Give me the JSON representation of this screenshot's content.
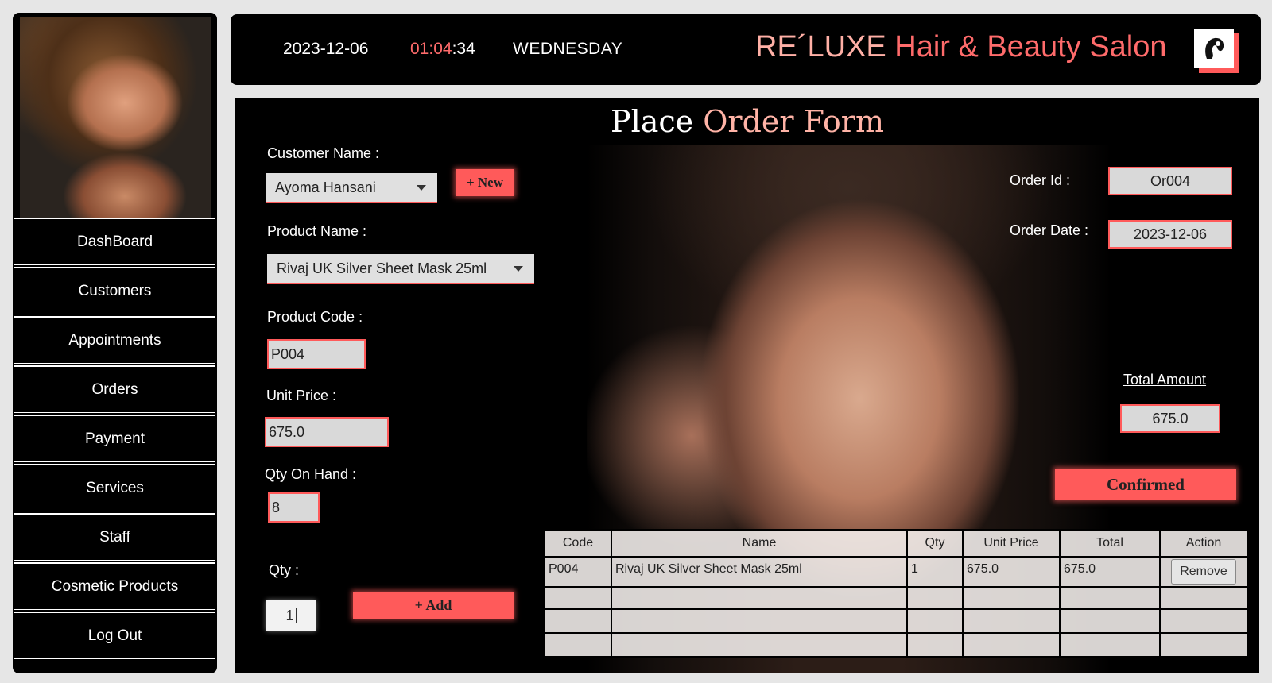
{
  "header": {
    "date": "2023-12-06",
    "time_hm": "01:04",
    "time_s": ":34",
    "day": "WEDNESDAY",
    "brand_1": "RE´LUXE",
    "brand_2": "Hair & Beauty Salon",
    "logo_icon": "salon-logo-icon"
  },
  "sidebar": {
    "items": [
      {
        "label": "DashBoard"
      },
      {
        "label": "Customers"
      },
      {
        "label": "Appointments"
      },
      {
        "label": "Orders"
      },
      {
        "label": "Payment"
      },
      {
        "label": "Services"
      },
      {
        "label": "Staff"
      },
      {
        "label": "Cosmetic Products"
      },
      {
        "label": "Log Out"
      }
    ]
  },
  "form": {
    "title_1": "Place",
    "title_2": "Order Form",
    "customer_label": "Customer  Name :",
    "customer_value": "Ayoma Hansani",
    "new_button": "+ New",
    "product_label": "Product Name :",
    "product_value": "Rivaj UK Silver Sheet Mask 25ml",
    "code_label": "Product Code :",
    "code_value": "P004",
    "price_label": "Unit Price :",
    "price_value": "675.0",
    "qoh_label": "Qty On Hand :",
    "qoh_value": "8",
    "qty_label": "Qty :",
    "qty_value": "1",
    "add_button": "+ Add",
    "order_id_label": "Order Id :",
    "order_id_value": "Or004",
    "order_date_label": "Order Date :",
    "order_date_value": "2023-12-06",
    "total_label": "Total Amount",
    "total_value": "675.0",
    "confirm_button": "Confirmed"
  },
  "table": {
    "headers": [
      "Code",
      "Name",
      "Qty",
      "Unit Price",
      "Total",
      "Action"
    ],
    "rows": [
      {
        "code": "P004",
        "name": "Rivaj UK Silver Sheet Mask 25ml",
        "qty": "1",
        "unit_price": "675.0",
        "total": "675.0",
        "action": "Remove"
      }
    ]
  },
  "colors": {
    "accent": "#ff5a5a",
    "brand_pink": "#ffb0a6",
    "background": "#000000"
  }
}
